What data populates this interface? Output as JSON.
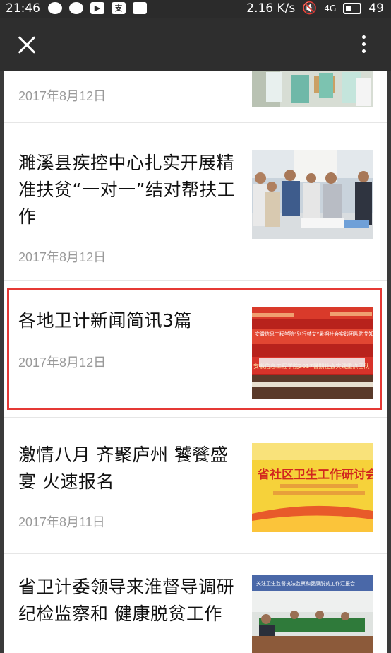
{
  "status_bar": {
    "time": "21:46",
    "speed": "2.16 K/s",
    "network": "4G",
    "battery": "49"
  },
  "header": {
    "close_icon": "close-icon",
    "more_icon": "more-vertical-icon"
  },
  "articles": [
    {
      "title": "",
      "date": "2017年8月12日"
    },
    {
      "title": "濉溪县疾控中心扎实开展精准扶贫“一对一”结对帮扶工作",
      "date": "2017年8月12日"
    },
    {
      "title": "各地卫计新闻简讯3篇",
      "date": "2017年8月12日"
    },
    {
      "title": "激情八月 齐聚庐州 饕餮盛宴 火速报名",
      "date": "2017年8月11日"
    },
    {
      "title": "省卫计委领导来淮督导调研纪检监察和 健康脱贫工作",
      "date": ""
    }
  ],
  "thumbs": {
    "item2_banner_top": "安徽信息工程学院“别行禁艾”暑期社会实践团队防艾知识培训讲座",
    "item2_banner_bottom": "安徽信息工程学院2017暑期社会实践重点团队",
    "item3_banner": "省社区卫生工作研讨会",
    "item4_banner": "关注卫生监督执法监察和健康脱贫工作汇报会"
  },
  "colors": {
    "highlight": "#e53935",
    "date": "#999999"
  }
}
